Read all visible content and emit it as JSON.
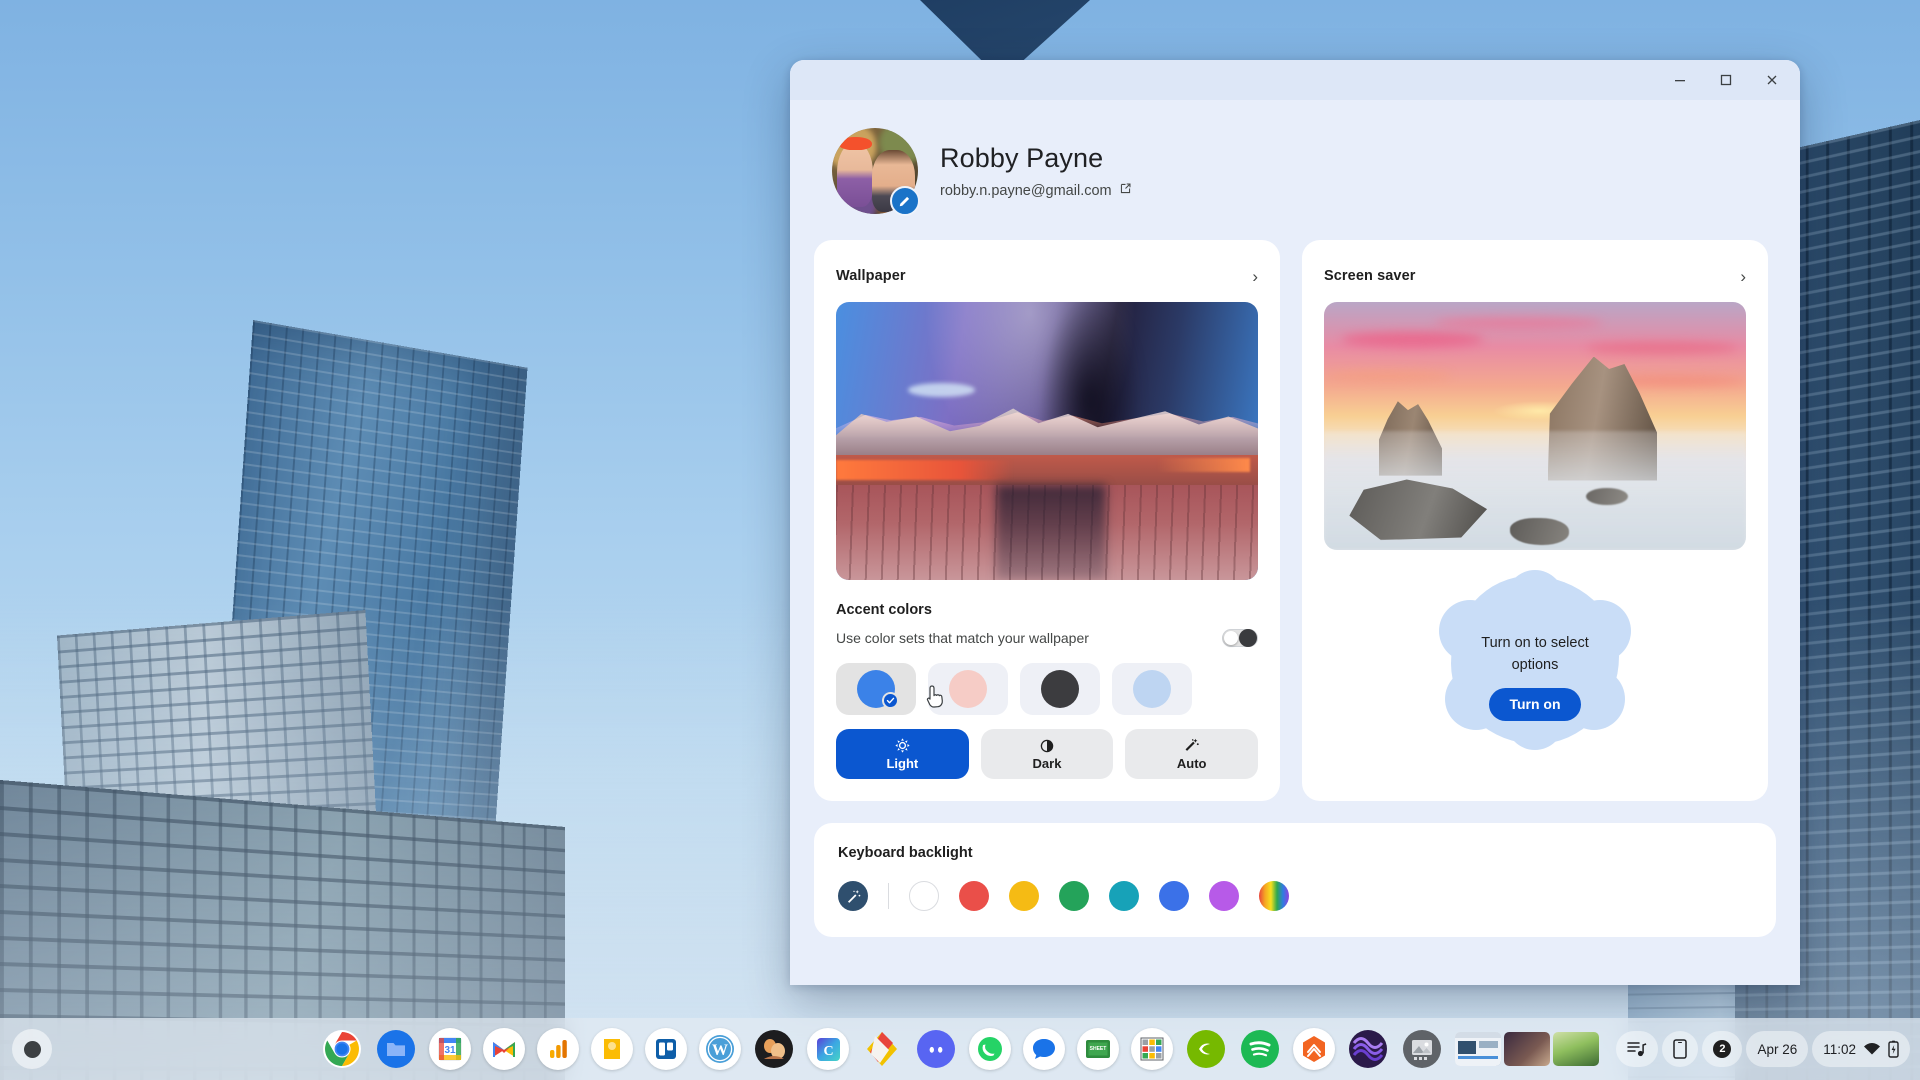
{
  "window": {
    "controls": {
      "minimize": "Minimize",
      "maximize": "Maximize",
      "close": "Close"
    }
  },
  "profile": {
    "name": "Robby Payne",
    "email": "robby.n.payne@gmail.com",
    "external_link_icon": "external-link-icon",
    "edit_icon": "pencil-icon",
    "avatar_alt": "Profile photo"
  },
  "wallpaper_card": {
    "title": "Wallpaper",
    "chevron": "›",
    "preview_alt": "Desert canyon wallpaper preview",
    "accent": {
      "title": "Accent colors",
      "toggle_label": "Use color sets that match your wallpaper",
      "toggle_state": "off",
      "swatches": [
        {
          "name": "blue",
          "color": "#3b82e8",
          "selected": true
        },
        {
          "name": "pink",
          "color": "#f6ccc6",
          "selected": false
        },
        {
          "name": "dark",
          "color": "#3c3c3f",
          "selected": false
        },
        {
          "name": "light-blue",
          "color": "#bed5f2",
          "selected": false
        }
      ]
    },
    "modes": [
      {
        "label": "Light",
        "icon": "sun-icon",
        "active": true
      },
      {
        "label": "Dark",
        "icon": "half-circle-icon",
        "active": false
      },
      {
        "label": "Auto",
        "icon": "magic-wand-icon",
        "active": false
      }
    ]
  },
  "screensaver_card": {
    "title": "Screen saver",
    "chevron": "›",
    "preview_alt": "Sunset sea stacks screen saver preview",
    "empty_text": "Turn on to select options",
    "turn_on_label": "Turn on"
  },
  "keyboard_backlight": {
    "title": "Keyboard backlight",
    "swatches": [
      {
        "name": "auto-wand",
        "color": "#2f4f6e"
      },
      {
        "name": "white",
        "color": "#ffffff"
      },
      {
        "name": "red",
        "color": "#ea4f49"
      },
      {
        "name": "yellow",
        "color": "#f5bb14"
      },
      {
        "name": "green",
        "color": "#24a35a"
      },
      {
        "name": "teal",
        "color": "#17a2b8"
      },
      {
        "name": "blue",
        "color": "#3b71e8"
      },
      {
        "name": "purple",
        "color": "#b martin"
      },
      {
        "name": "rainbow",
        "color": "rainbow"
      }
    ]
  },
  "shelf": {
    "launcher": "Launcher",
    "apps": [
      {
        "name": "chrome",
        "label": "Chrome"
      },
      {
        "name": "files",
        "label": "Files"
      },
      {
        "name": "calendar",
        "label": "Calendar",
        "day": "31"
      },
      {
        "name": "gmail",
        "label": "Gmail"
      },
      {
        "name": "analytics",
        "label": "Analytics"
      },
      {
        "name": "keep",
        "label": "Keep"
      },
      {
        "name": "trello",
        "label": "Trello"
      },
      {
        "name": "wordpress",
        "label": "WordPress"
      },
      {
        "name": "podcast",
        "label": "Podcast"
      },
      {
        "name": "canva",
        "label": "Canva"
      },
      {
        "name": "colorapp",
        "label": "Color app"
      },
      {
        "name": "discord",
        "label": "Discord"
      },
      {
        "name": "whatsapp",
        "label": "WhatsApp"
      },
      {
        "name": "messages",
        "label": "Messages"
      },
      {
        "name": "greenapp",
        "label": "Green app"
      },
      {
        "name": "grid",
        "label": "Grid app"
      },
      {
        "name": "nvidia",
        "label": "NVIDIA"
      },
      {
        "name": "spotify",
        "label": "Spotify"
      },
      {
        "name": "orange-hex",
        "label": "Orange app"
      },
      {
        "name": "purple-orb",
        "label": "Purple app"
      },
      {
        "name": "gallery",
        "label": "Gallery",
        "active": true
      }
    ],
    "tray": {
      "media_icon": "media-playlist-icon",
      "phone_icon": "phone-hub-icon",
      "notification_count": "2",
      "date": "Apr 26",
      "time": "11:02",
      "wifi_icon": "wifi-icon",
      "battery_icon": "battery-icon"
    }
  }
}
